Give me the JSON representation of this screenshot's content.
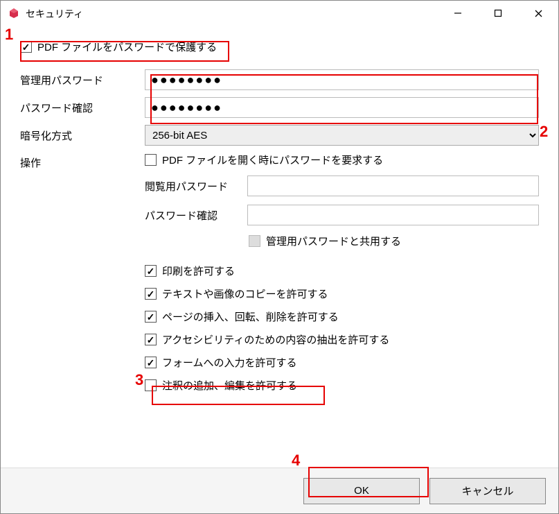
{
  "window": {
    "title": "セキュリティ"
  },
  "protect": {
    "checkbox_label": "PDF ファイルをパスワードで保護する",
    "checked": true
  },
  "fields": {
    "admin_pw_label": "管理用パスワード",
    "admin_pw_value": "●●●●●●●●",
    "confirm_pw_label": "パスワード確認",
    "confirm_pw_value": "●●●●●●●●",
    "encryption_label": "暗号化方式",
    "encryption_value": "256-bit AES",
    "operations_label": "操作"
  },
  "ops": {
    "require_open_pw": {
      "label": "PDF ファイルを開く時にパスワードを要求する",
      "checked": false
    },
    "view_pw_label": "閲覧用パスワード",
    "view_confirm_label": "パスワード確認",
    "share_admin": {
      "label": "管理用パスワードと共用する",
      "checked": false,
      "disabled": true
    },
    "allow_print": {
      "label": "印刷を許可する",
      "checked": true
    },
    "allow_copy": {
      "label": "テキストや画像のコピーを許可する",
      "checked": true
    },
    "allow_pages": {
      "label": "ページの挿入、回転、削除を許可する",
      "checked": true
    },
    "allow_access": {
      "label": "アクセシビリティのための内容の抽出を許可する",
      "checked": true
    },
    "allow_form": {
      "label": "フォームへの入力を許可する",
      "checked": true
    },
    "allow_annot": {
      "label": "注釈の追加、編集を許可する",
      "checked": false
    }
  },
  "footer": {
    "ok": "OK",
    "cancel": "キャンセル"
  },
  "annotations": {
    "n1": "1",
    "n2": "2",
    "n3": "3",
    "n4": "4"
  }
}
